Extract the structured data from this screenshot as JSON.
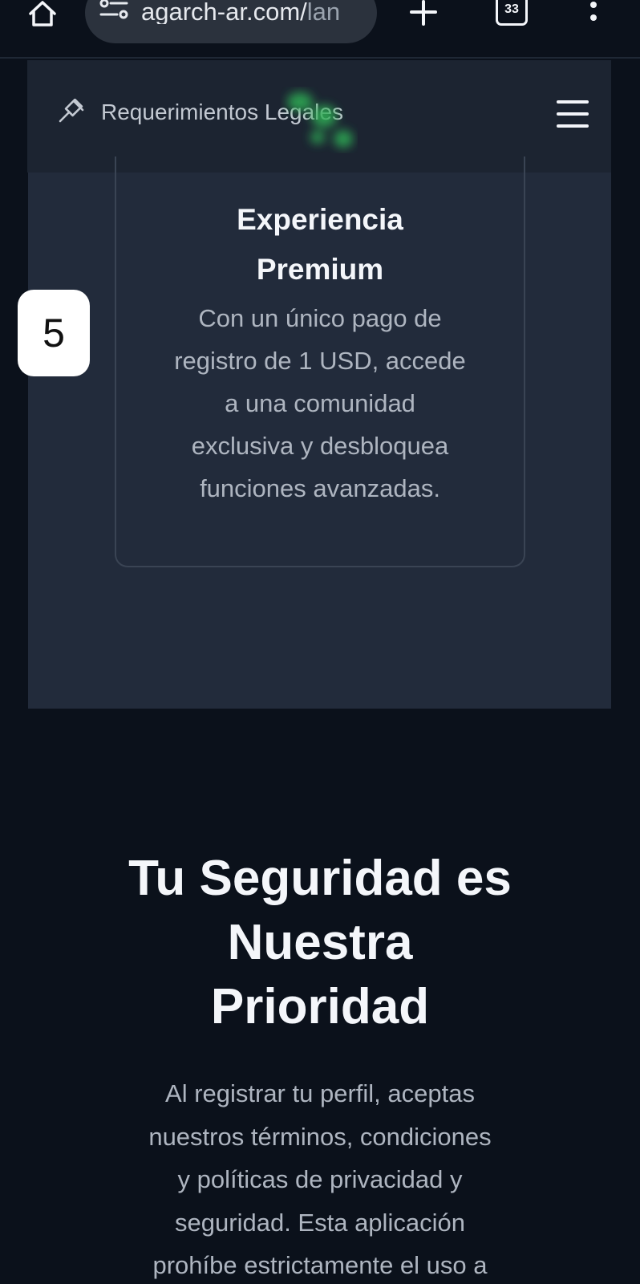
{
  "browser": {
    "url_visible": "agarch-ar.com/",
    "url_faded": "lan",
    "tab_count": "33"
  },
  "header": {
    "brand_label": "Requerimientos Legales"
  },
  "feature": {
    "step_number": "5",
    "title_line1": "Experiencia",
    "title_line2": "Premium",
    "text_lines": [
      "Con un único pago de",
      "registro de 1 USD, accede",
      "a una comunidad",
      "exclusiva y desbloquea",
      "funciones avanzadas."
    ]
  },
  "security": {
    "title_lines": [
      "Tu Seguridad es",
      "Nuestra",
      "Prioridad"
    ],
    "text_lines": [
      "Al registrar tu perfil, aceptas",
      "nuestros términos, condiciones",
      "y políticas de privacidad y",
      "seguridad. Esta aplicación",
      "prohíbe estrictamente el uso a"
    ]
  },
  "colors": {
    "page_bg": "#0b111b",
    "section_bg": "#222b3b",
    "header_bg": "#1c2431",
    "accent_blur": "#2fae54"
  },
  "icons": {
    "home": "home-icon",
    "site_settings": "tune-icon",
    "new_tab": "plus-icon",
    "tabs": "tab-switcher-icon",
    "overflow": "more-vert-icon",
    "brand": "gavel-icon",
    "menu": "hamburger-menu-icon"
  }
}
